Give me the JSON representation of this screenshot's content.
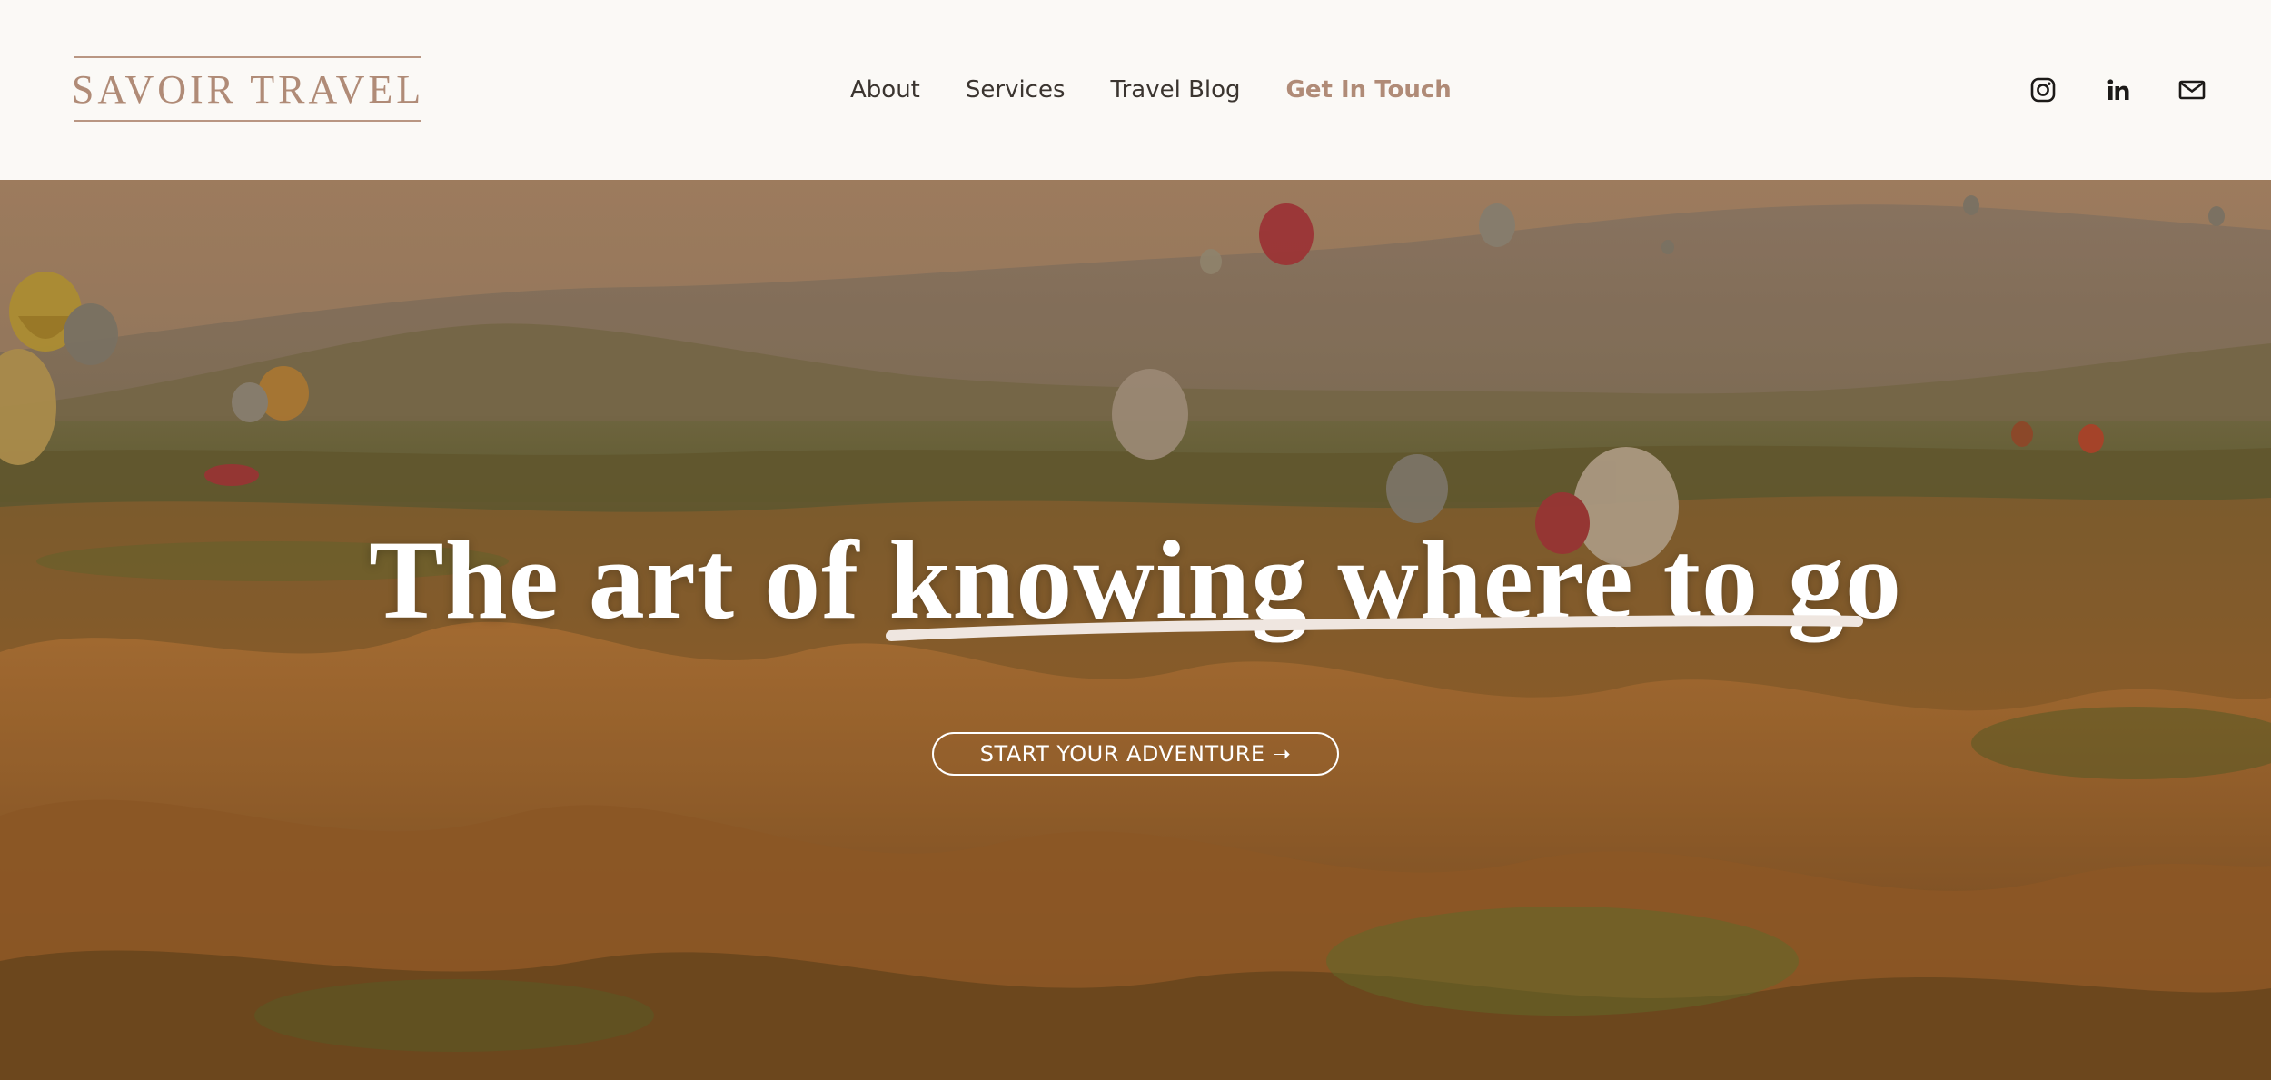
{
  "brand": {
    "name": "SAVOIR TRAVEL",
    "color": "#b08b77"
  },
  "nav": {
    "items": [
      {
        "label": "About"
      },
      {
        "label": "Services"
      },
      {
        "label": "Travel Blog"
      },
      {
        "label": "Get In Touch"
      }
    ],
    "accent_color": "#b08b77"
  },
  "social": {
    "icons": [
      "instagram-icon",
      "linkedin-icon",
      "mail-icon"
    ]
  },
  "hero": {
    "headline": "The art of knowing where to go",
    "cta_label": "START YOUR ADVENTURE ➝",
    "image_subject": "hot air balloons over Cappadocia valley at sunrise"
  }
}
